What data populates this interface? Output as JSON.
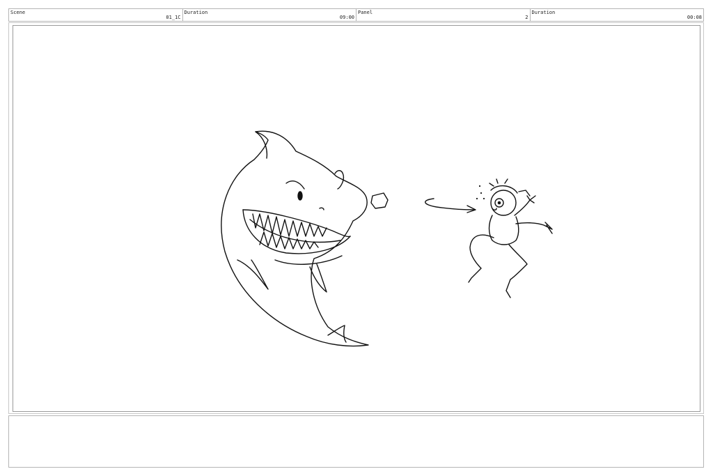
{
  "header": {
    "fields": [
      {
        "label": "Scene",
        "value": "01_1C"
      },
      {
        "label": "Duration",
        "value": "09:00"
      },
      {
        "label": "Panel",
        "value": "2"
      },
      {
        "label": "Duration",
        "value": "00:08"
      }
    ]
  },
  "notes": {
    "text": ""
  }
}
